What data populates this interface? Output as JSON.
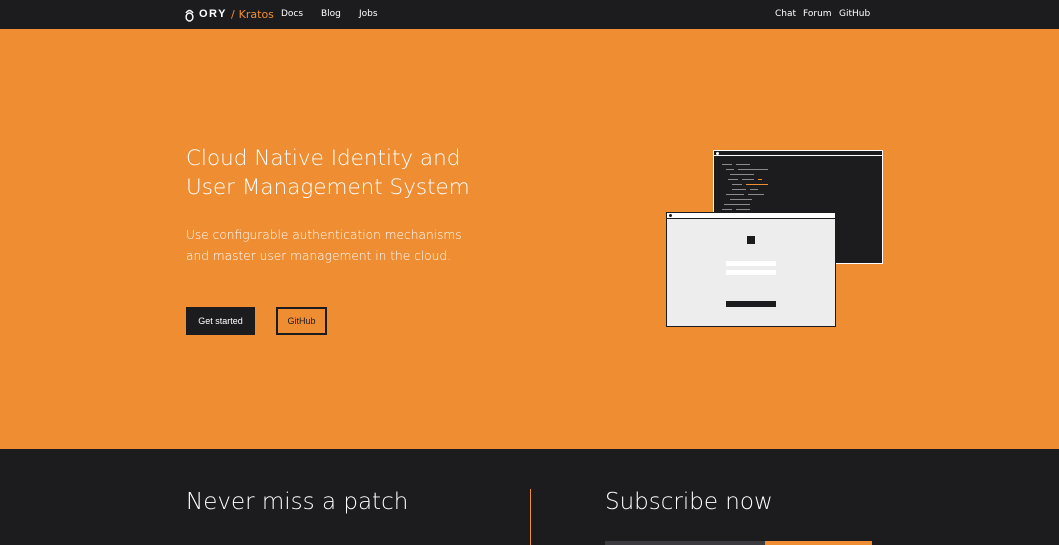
{
  "nav": {
    "logo_brand": "ORY",
    "logo_separator": "/",
    "logo_product": "Kratos",
    "left_links": [
      "Docs",
      "Blog",
      "Jobs"
    ],
    "right_links": [
      "Chat",
      "Forum",
      "GitHub"
    ]
  },
  "hero": {
    "title": "Cloud Native Identity and User Management System",
    "subtitle": "Use configurable authentication mechanisms and master user management in the cloud.",
    "primary_button": "Get started",
    "secondary_button": "GitHub"
  },
  "footer": {
    "left_title": "Never miss a patch",
    "right_title": "Subscribe now"
  },
  "colors": {
    "brand_orange": "#ef8d33",
    "dark": "#1c1c1f",
    "light_window": "#ededed"
  },
  "icons": {
    "logo": "ory-logo-icon"
  }
}
